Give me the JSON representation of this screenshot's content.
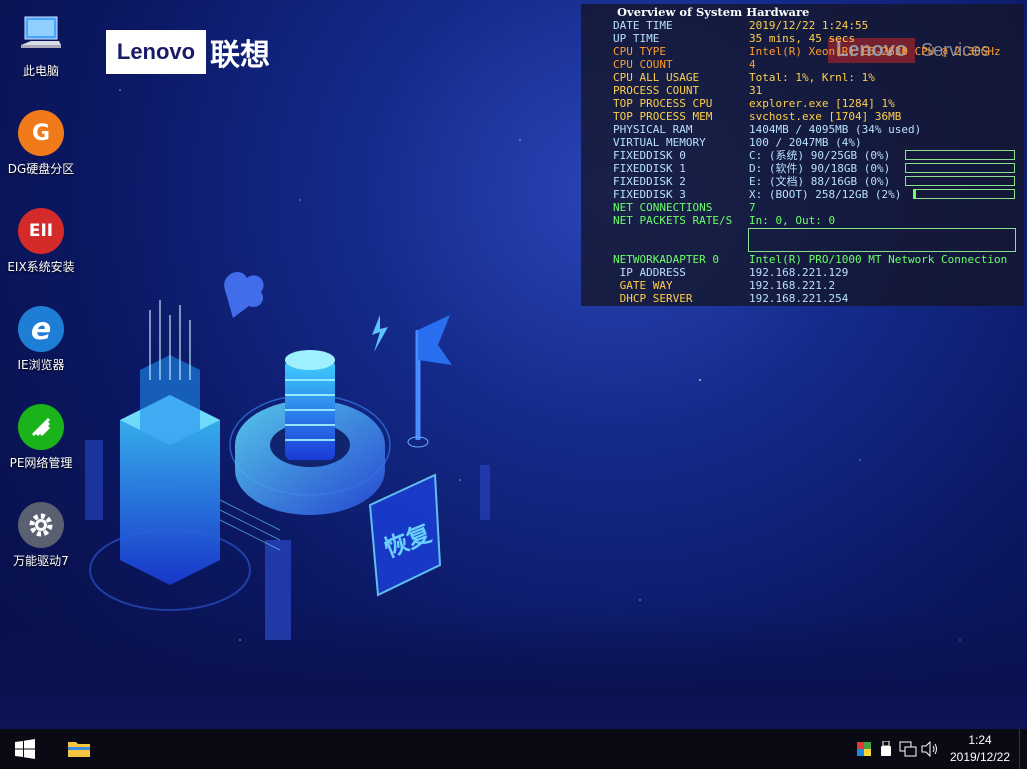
{
  "desktop": {
    "icons": [
      {
        "label": "此电脑",
        "icon": "computer-icon"
      },
      {
        "label": "DG硬盘分区",
        "icon": "diskgenius-icon",
        "glyph": "G",
        "color": "#f07a1a"
      },
      {
        "label": "EIX系统安装",
        "icon": "eix-install-icon",
        "glyph": "EII",
        "color": "#d42a2a"
      },
      {
        "label": "IE浏览器",
        "icon": "ie-browser-icon",
        "glyph": "e",
        "color": "#1e7ed6"
      },
      {
        "label": "PE网络管理",
        "icon": "network-manager-icon",
        "color": "#1ab31a"
      },
      {
        "label": "万能驱动7",
        "icon": "gear-icon",
        "color": "#5a6070"
      }
    ],
    "logo": {
      "brand": "Lenovo",
      "cn": "联想"
    },
    "wallpaper_sign": "恢复"
  },
  "sysinfo": {
    "title": "Overview of System Hardware",
    "services_brand": "Lenovo",
    "services_word": "Services",
    "rows": [
      {
        "key": "DATE TIME",
        "value": "2019/12/22 1:24:55"
      },
      {
        "key": "UP TIME",
        "value": "35 mins, 45 secs"
      },
      {
        "key": "CPU TYPE",
        "value": "Intel(R) Xeon(R) E5-2630 CPU @ 2.30GHz"
      },
      {
        "key": "CPU COUNT",
        "value": "4"
      },
      {
        "key": "CPU ALL USAGE",
        "value": "Total: 1%, Krnl: 1%"
      },
      {
        "key": "PROCESS COUNT",
        "value": "31"
      },
      {
        "key": "TOP PROCESS CPU",
        "value": "explorer.exe [1284] 1%"
      },
      {
        "key": "TOP PROCESS MEM",
        "value": "svchost.exe [1704] 36MB"
      },
      {
        "key": "PHYSICAL RAM",
        "value": "1404MB / 4095MB (34% used)"
      },
      {
        "key": "VIRTUAL MEMORY",
        "value": "100 / 2047MB (4%)"
      },
      {
        "key": "FIXEDDISK 0",
        "value": "C: (系统) 90/25GB (0%)",
        "usage": 0
      },
      {
        "key": "FIXEDDISK 1",
        "value": "D: (软件) 90/18GB (0%)",
        "usage": 0
      },
      {
        "key": "FIXEDDISK 2",
        "value": "E: (文档) 88/16GB (0%)",
        "usage": 0
      },
      {
        "key": "FIXEDDISK 3",
        "value": "X: (BOOT) 258/12GB (2%)",
        "usage": 2
      },
      {
        "key": "NET CONNECTIONS",
        "value": "7"
      },
      {
        "key": "NET PACKETS RATE/S",
        "value": "In: 0, Out: 0"
      },
      {
        "key": "NETWORKADAPTER 0",
        "value": "Intel(R) PRO/1000 MT Network Connection"
      },
      {
        "key": " IP ADDRESS",
        "value": "192.168.221.129"
      },
      {
        "key": " GATE WAY",
        "value": "192.168.221.2"
      },
      {
        "key": " DHCP SERVER",
        "value": "192.168.221.254"
      }
    ]
  },
  "taskbar": {
    "time": "1:24",
    "date": "2019/12/22",
    "tray": [
      "color-app-icon",
      "usb-icon",
      "network-icon",
      "volume-icon"
    ]
  }
}
